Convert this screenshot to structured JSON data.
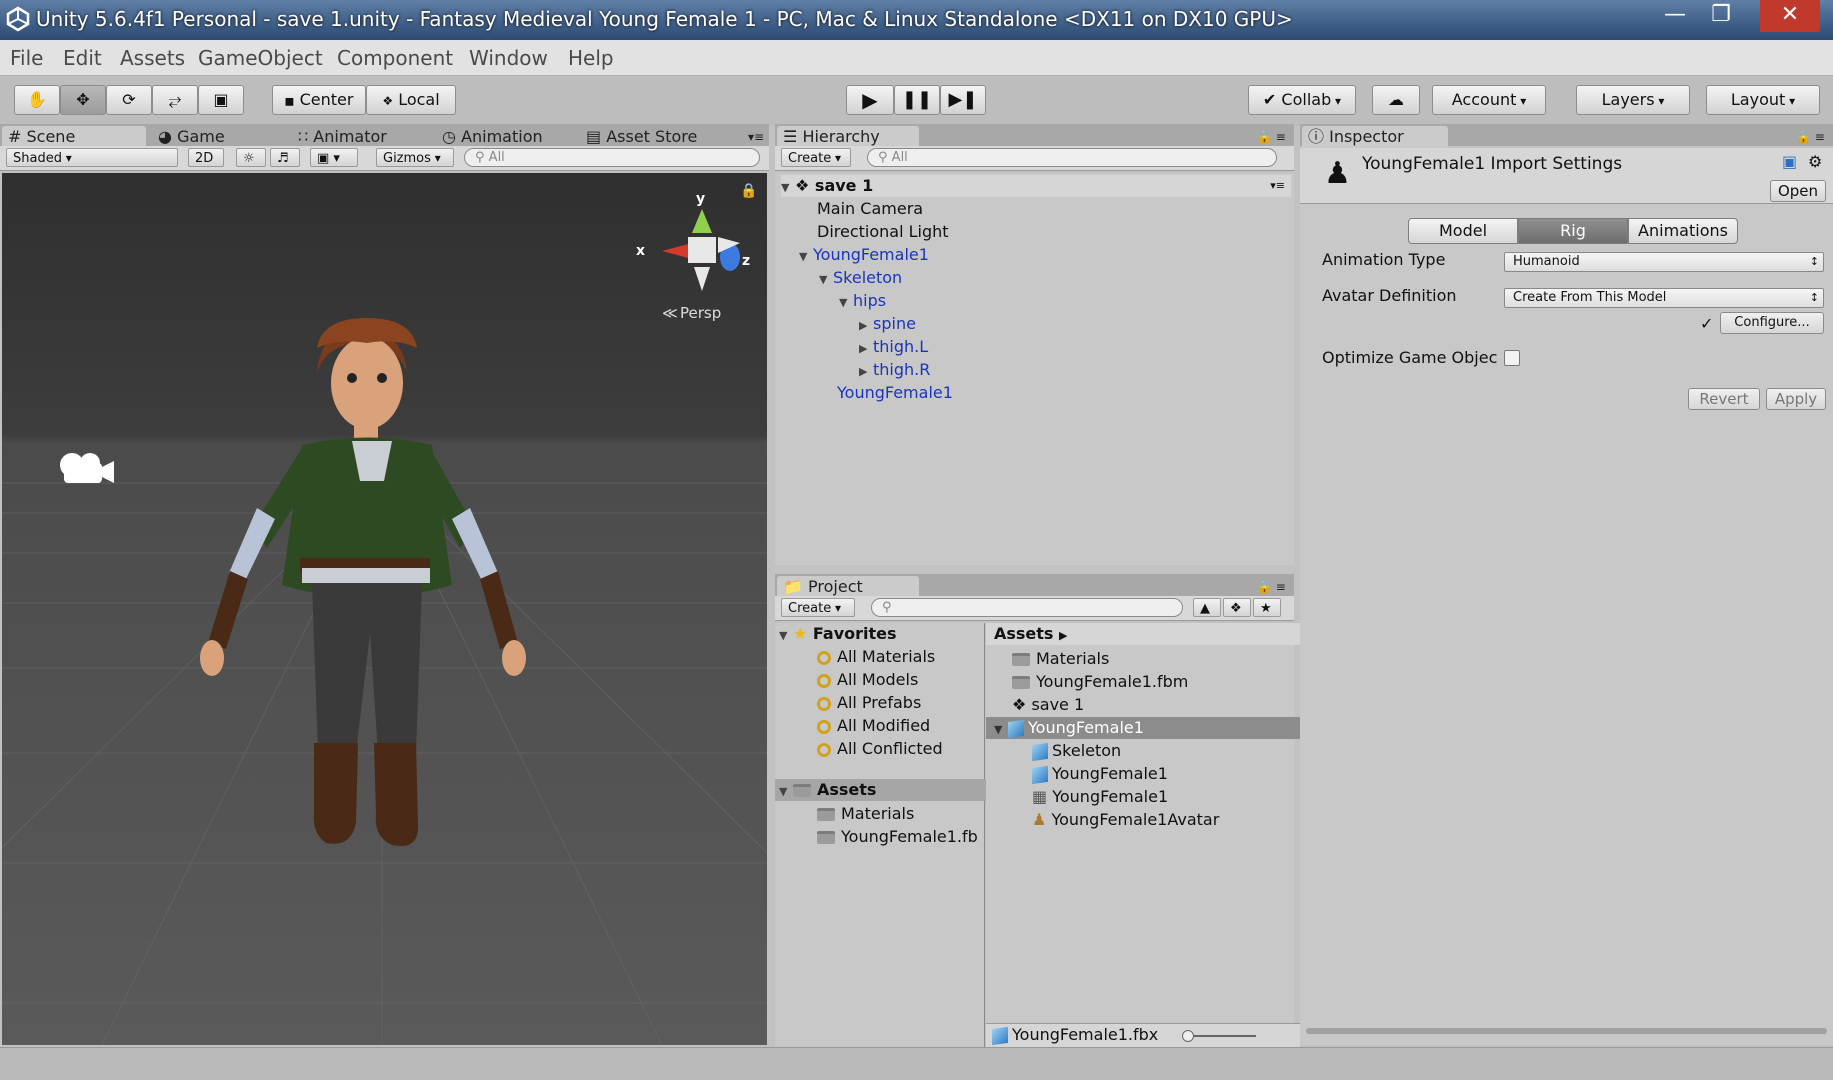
{
  "window": {
    "title": "Unity 5.6.4f1 Personal - save 1.unity - Fantasy Medieval Young Female 1 - PC, Mac & Linux Standalone <DX11 on DX10 GPU>",
    "minimize": "—",
    "maximize": "❐",
    "close": "✕"
  },
  "menu": [
    "File",
    "Edit",
    "Assets",
    "GameObject",
    "Component",
    "Window",
    "Help"
  ],
  "toolbar": {
    "pivot": "Center",
    "space": "Local",
    "collab": "Collab",
    "account": "Account",
    "layers": "Layers",
    "layout": "Layout"
  },
  "tabs": {
    "scene": "Scene",
    "game": "Game",
    "animator": "Animator",
    "animation": "Animation",
    "asset_store": "Asset Store",
    "hierarchy": "Hierarchy",
    "project": "Project",
    "inspector": "Inspector"
  },
  "scene_toolbar": {
    "shading": "Shaded",
    "mode2d": "2D",
    "gizmos": "Gizmos",
    "search_placeholder": "All"
  },
  "scene": {
    "persp": "Persp",
    "axes": {
      "y": "y",
      "x": "x",
      "z": "z"
    }
  },
  "hierarchy": {
    "create": "Create",
    "search_placeholder": "All",
    "root": "save 1",
    "items": [
      "Main Camera",
      "Directional Light",
      "YoungFemale1",
      "Skeleton",
      "hips",
      "spine",
      "thigh.L",
      "thigh.R",
      "YoungFemale1"
    ]
  },
  "project": {
    "create": "Create",
    "favorites": {
      "label": "Favorites",
      "items": [
        "All Materials",
        "All Models",
        "All Prefabs",
        "All Modified",
        "All Conflicted"
      ]
    },
    "assets_tree": {
      "label": "Assets",
      "items": [
        "Materials",
        "YoungFemale1.fb"
      ]
    },
    "breadcrumb": "Assets",
    "assets": [
      "Materials",
      "YoungFemale1.fbm",
      "save 1",
      "YoungFemale1",
      "Skeleton",
      "YoungFemale1",
      "YoungFemale1",
      "YoungFemale1Avatar"
    ],
    "footer_file": "YoungFemale1.fbx"
  },
  "inspector": {
    "title": "YoungFemale1 Import Settings",
    "open": "Open",
    "tabs": [
      "Model",
      "Rig",
      "Animations"
    ],
    "animation_type_label": "Animation Type",
    "animation_type_value": "Humanoid",
    "avatar_def_label": "Avatar Definition",
    "avatar_def_value": "Create From This Model",
    "configured_check": "✓",
    "configure": "Configure...",
    "optimize_label": "Optimize Game Objec",
    "revert": "Revert",
    "apply": "Apply"
  },
  "colors": {
    "selection_blue": "#1a35b8",
    "title_bar": "#3f5f88",
    "selected_row": "#a6a6a6"
  }
}
